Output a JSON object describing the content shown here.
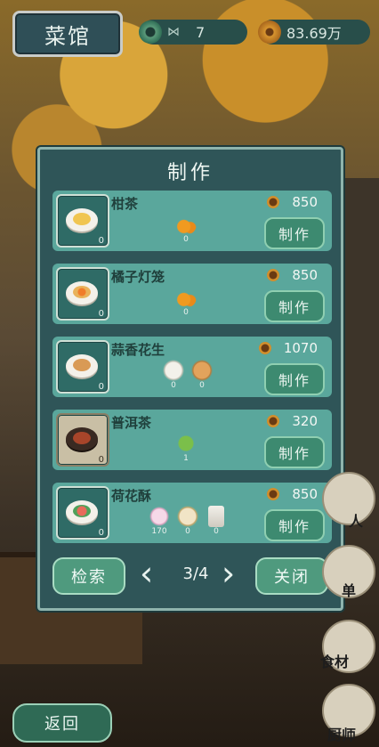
{
  "header": {
    "shop_title": "菜馆",
    "jade_count": "7",
    "copper_amount": "83.69万"
  },
  "panel": {
    "title": "制作",
    "make_label": "制作",
    "recipes": [
      {
        "name": "柑茶",
        "price": "850",
        "count": "0",
        "ingredients": [
          {
            "icon": "orange-branch-icon",
            "count": "0"
          }
        ]
      },
      {
        "name": "橘子灯笼",
        "price": "850",
        "count": "0",
        "ingredients": [
          {
            "icon": "orange-branch-icon",
            "count": "0"
          }
        ]
      },
      {
        "name": "蒜香花生",
        "price": "1070",
        "count": "0",
        "ingredients": [
          {
            "icon": "garlic-icon",
            "count": "0"
          },
          {
            "icon": "peanut-icon",
            "count": "0"
          }
        ]
      },
      {
        "name": "普洱茶",
        "price": "320",
        "count": "0",
        "ingredients": [
          {
            "icon": "tea-leaf-icon",
            "count": "1"
          }
        ]
      },
      {
        "name": "荷花酥",
        "price": "850",
        "count": "0",
        "ingredients": [
          {
            "icon": "lotus-icon",
            "count": "170"
          },
          {
            "icon": "flour-icon",
            "count": "0"
          },
          {
            "icon": "sugar-jar-icon",
            "count": "0"
          }
        ]
      }
    ],
    "search_label": "检索",
    "page": "3/4",
    "close_label": "关闭"
  },
  "side": {
    "menu_label": "单",
    "ingredients_label": "食材",
    "chef_label": "厨师",
    "person_label": "人"
  },
  "footer": {
    "back_label": "返回"
  },
  "colors": {
    "panel": "#2f5558",
    "card": "#5aa79c",
    "button": "#3d8a70"
  }
}
